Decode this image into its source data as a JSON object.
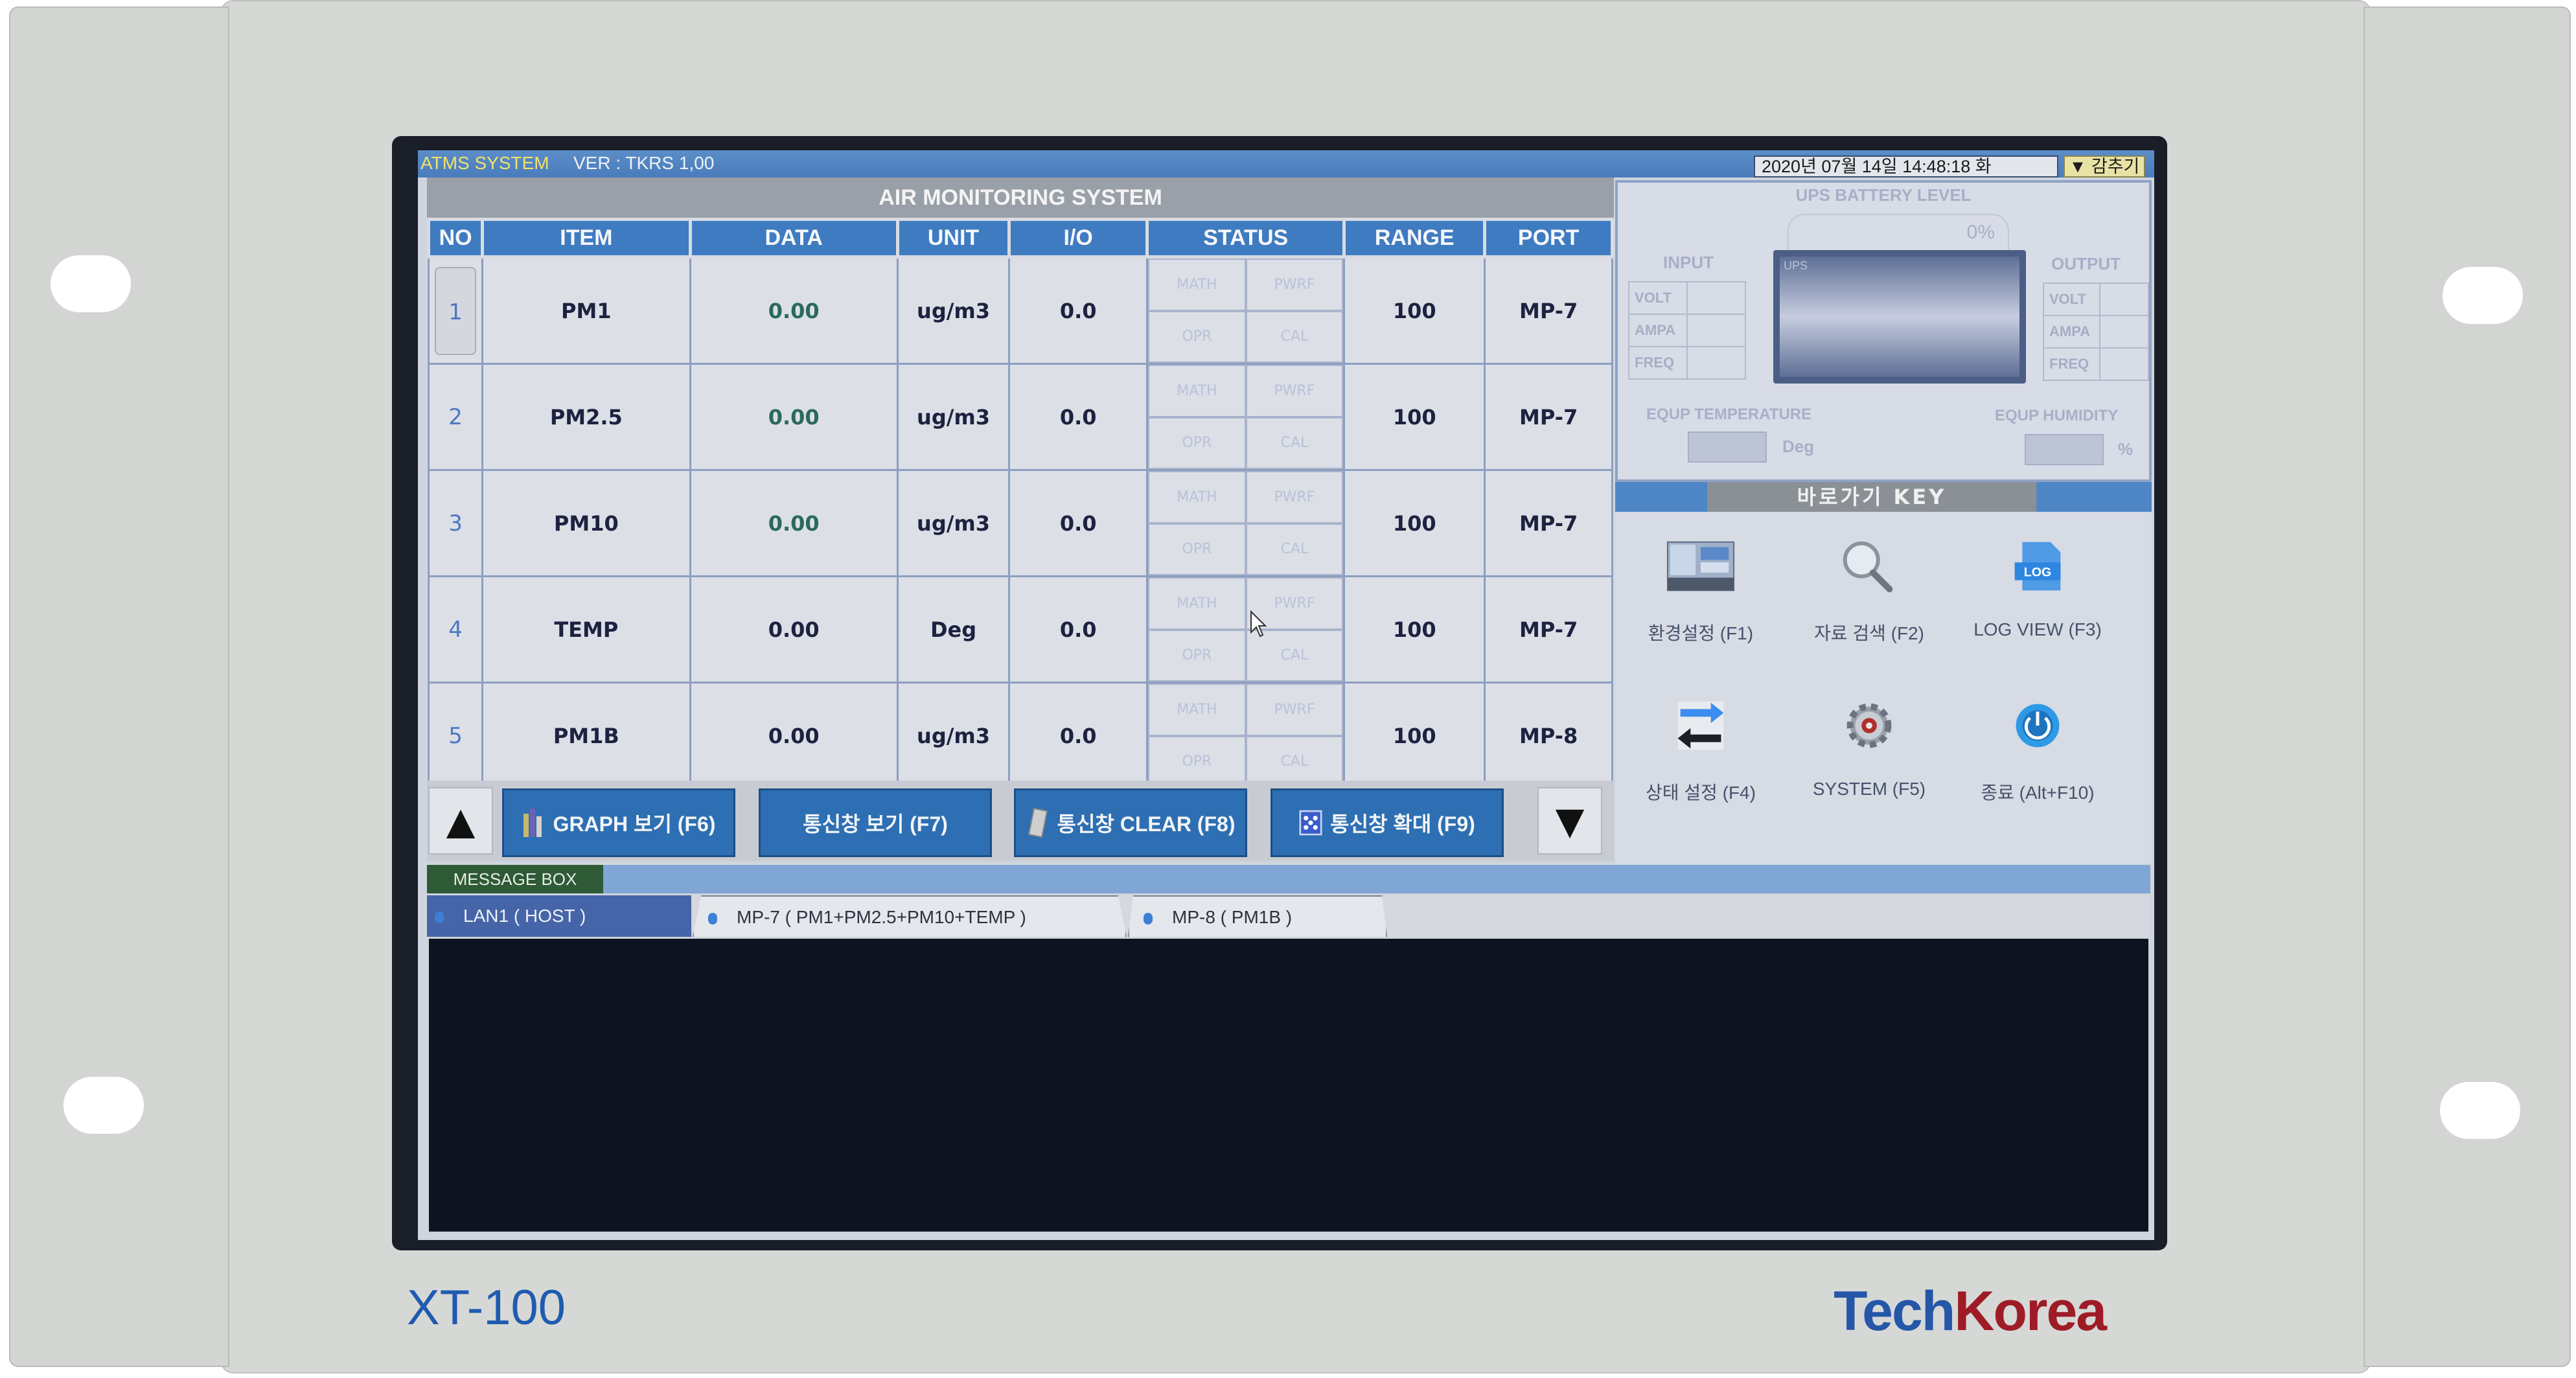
{
  "device": {
    "model_label": "XT-100",
    "brand_part1": "Tech",
    "brand_part2": "Korea",
    "brand_colors": {
      "tech": "#2457a8",
      "korea": "#9e1c26"
    }
  },
  "topbar": {
    "app_name": "ATMS SYSTEM",
    "version": "VER : TKRS 1,00",
    "datetime": "2020년 07월 14일 14:48:18   화",
    "hide_button": "▼ 감추기"
  },
  "main": {
    "title": "AIR MONITORING SYSTEM",
    "columns": [
      "NO",
      "ITEM",
      "DATA",
      "UNIT",
      "I/O",
      "STATUS",
      "RANGE",
      "PORT"
    ],
    "status_labels": [
      "MATH",
      "PWRF",
      "OPR",
      "CAL"
    ],
    "rows": [
      {
        "no": "1",
        "item": "PM1",
        "data": "0.00",
        "unit": "ug/m3",
        "io": "0.0",
        "range": "100",
        "port": "MP-7"
      },
      {
        "no": "2",
        "item": "PM2.5",
        "data": "0.00",
        "unit": "ug/m3",
        "io": "0.0",
        "range": "100",
        "port": "MP-7"
      },
      {
        "no": "3",
        "item": "PM10",
        "data": "0.00",
        "unit": "ug/m3",
        "io": "0.0",
        "range": "100",
        "port": "MP-7"
      },
      {
        "no": "4",
        "item": "TEMP",
        "data": "0.00",
        "unit": "Deg",
        "io": "0.0",
        "range": "100",
        "port": "MP-7"
      },
      {
        "no": "5",
        "item": "PM1B",
        "data": "0.00",
        "unit": "ug/m3",
        "io": "0.0",
        "range": "100",
        "port": "MP-8"
      }
    ]
  },
  "buttons": {
    "scroll_up": "▲",
    "scroll_down": "▼",
    "graph": "GRAPH 보기 (F6)",
    "comm_view": "통신창 보기 (F7)",
    "comm_clear": "통신창 CLEAR (F8)",
    "comm_expand": "통신창 확대 (F9)"
  },
  "message_box": {
    "label": "MESSAGE BOX",
    "tabs": [
      {
        "label": "LAN1  ( HOST )",
        "active": true
      },
      {
        "label": "MP-7  ( PM1+PM2.5+PM10+TEMP )",
        "active": false
      },
      {
        "label": "MP-8  ( PM1B )",
        "active": false
      }
    ]
  },
  "ups": {
    "title": "UPS BATTERY LEVEL",
    "level_percent": "0%",
    "battery_label": "UPS",
    "input_title": "INPUT",
    "output_title": "OUTPUT",
    "rows": [
      "VOLT",
      "AMPA",
      "FREQ"
    ],
    "equip_temp_label": "EQUP  TEMPERATURE",
    "equip_temp_unit": "Deg",
    "equip_humidity_label": "EQUP  HUMIDITY",
    "equip_humidity_unit": "%"
  },
  "shortcuts": {
    "title": "바로가기 KEY",
    "items": [
      {
        "label": "환경설정 (F1)",
        "icon": "settings-screen-icon"
      },
      {
        "label": "자료 검색 (F2)",
        "icon": "magnifier-icon"
      },
      {
        "label": "LOG VIEW (F3)",
        "icon": "log-file-icon"
      },
      {
        "label": "상태 설정  (F4)",
        "icon": "swap-arrows-icon"
      },
      {
        "label": "SYSTEM  (F5)",
        "icon": "gear-icon"
      },
      {
        "label": "종료 (Alt+F10)",
        "icon": "power-icon"
      }
    ]
  }
}
